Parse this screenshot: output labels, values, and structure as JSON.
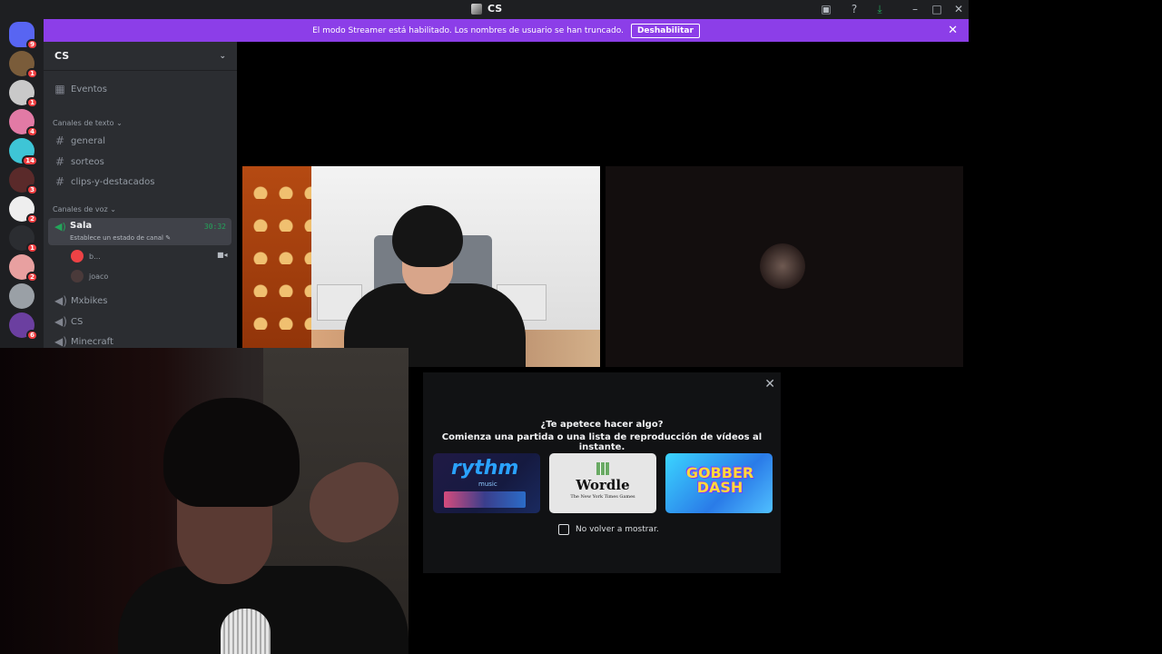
{
  "window": {
    "title": "CS"
  },
  "titlebar_icons": [
    "screen-icon",
    "help-icon",
    "download-icon",
    "minimize-icon",
    "maximize-icon",
    "close-icon"
  ],
  "streamer_banner": {
    "text": "El modo Streamer está habilitado. Los nombres de usuario se han truncado.",
    "button": "Deshabilitar"
  },
  "guilds": [
    {
      "name": "discord-home",
      "badge": "9",
      "color": "#5865f2"
    },
    {
      "name": "guild-1",
      "badge": "1",
      "color": "#7a5c3a"
    },
    {
      "name": "guild-2",
      "badge": "1",
      "color": "#c9c9c9"
    },
    {
      "name": "guild-3",
      "badge": "4",
      "color": "#e27aa5"
    },
    {
      "name": "guild-4",
      "badge": "14",
      "color": "#3ec5d6"
    },
    {
      "name": "guild-5",
      "badge": "3",
      "color": "#5a2a2a"
    },
    {
      "name": "guild-6",
      "badge": "2",
      "color": "#eeeeee"
    },
    {
      "name": "guild-7",
      "badge": "1",
      "color": "#2b2d31"
    },
    {
      "name": "guild-8",
      "badge": "2",
      "color": "#e8a0a0"
    },
    {
      "name": "guild-9",
      "badge": "",
      "color": "#9aa0a6"
    },
    {
      "name": "guild-10",
      "badge": "6",
      "color": "#6b3fa0"
    }
  ],
  "server": {
    "name": "CS"
  },
  "sidebar": {
    "events": "Eventos",
    "text_category": "Canales de texto",
    "text_channels": [
      "general",
      "sorteos",
      "clips-y-destacados"
    ],
    "voice_category": "Canales de voz",
    "active_voice": {
      "name": "Sala",
      "time": "30:32",
      "status": "Establece un estado de canal"
    },
    "voice_users": [
      "b...",
      "joaco"
    ],
    "voice_channels": [
      "Mxbikes",
      "CS",
      "Minecraft"
    ]
  },
  "activity": {
    "title": "¿Te apetece hacer algo?",
    "subtitle": "Comienza una partida o una lista de reproducción de vídeos al instante.",
    "cards": {
      "rythm": "rythm",
      "rythm_sub": "music",
      "wordle": "Wordle",
      "wordle_by": "The New York Times Games",
      "gobber": "GOBBER DASH"
    },
    "checkbox_label": "No volver a mostrar."
  },
  "colors": {
    "accent": "#8c3ee8",
    "voice_green": "#23a55a",
    "sidebar": "#2b2d31"
  }
}
